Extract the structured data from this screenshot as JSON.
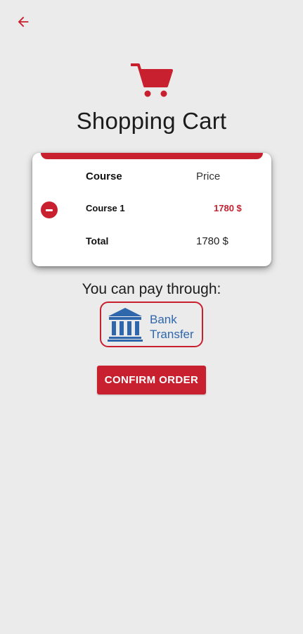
{
  "colors": {
    "accent": "#c8202f",
    "background": "#ebebeb",
    "bank_blue": "#2f67ad",
    "card": "#ffffff"
  },
  "header": {
    "back_icon": "arrow-left-icon",
    "cart_icon": "shopping-cart-icon",
    "title": "Shopping Cart"
  },
  "cart": {
    "columns": {
      "course": "Course",
      "price": "Price"
    },
    "items": [
      {
        "name": "Course 1",
        "price": "1780 $",
        "remove_icon": "remove-circle-icon"
      }
    ],
    "total_label": "Total",
    "total_value": "1780 $"
  },
  "payment": {
    "prompt": "You can pay through:",
    "methods": [
      {
        "icon": "bank-building-icon",
        "label_line1": "Bank",
        "label_line2": "Transfer"
      }
    ]
  },
  "actions": {
    "confirm_label": "CONFIRM ORDER"
  }
}
